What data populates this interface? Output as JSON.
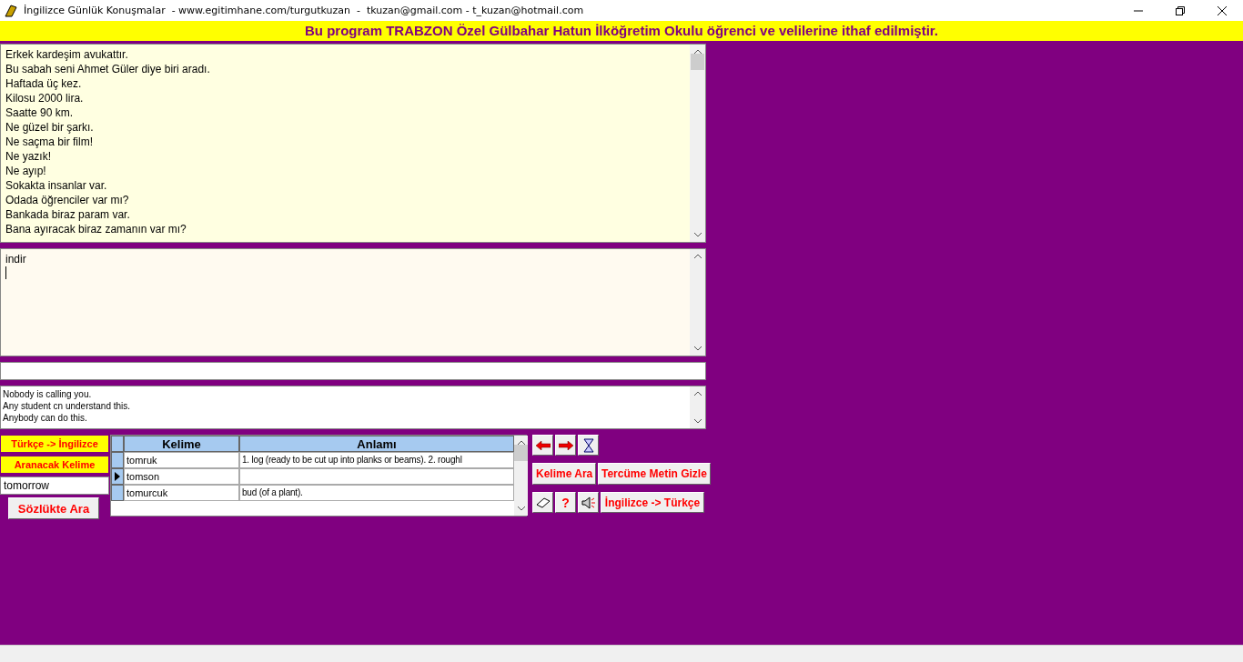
{
  "window": {
    "title": "İngilizce Günlük Konuşmalar  - www.egitimhane.com/turgutkuzan  -  tkuzan@gmail.com - t_kuzan@hotmail.com"
  },
  "banner": "Bu program TRABZON Özel Gülbahar Hatun İlköğretim Okulu öğrenci ve velilerine ithaf edilmiştir.",
  "sentences": [
    "Erkek kardeşim avukattır.",
    "Bu sabah seni Ahmet Güler diye biri aradı.",
    "Haftada üç kez.",
    "Kilosu 2000 lira.",
    "Saatte 90 km.",
    "Ne güzel bir şarkı.",
    "Ne saçma bir film!",
    "Ne yazık!",
    "Ne ayıp!",
    "Sokakta insanlar var.",
    "Odada öğrenciler var mı?",
    "Bankada biraz param var.",
    "Bana ayıracak biraz zamanın var mı?"
  ],
  "editor": {
    "value": "indir"
  },
  "examples": [
    "Nobody is calling you.",
    "Any student cn understand this.",
    "Anybody can do this."
  ],
  "direction_label": "Türkçe -> İngilizce",
  "search_label": "Aranacak Kelime",
  "search_value": "tomorrow",
  "search_button": "Sözlükte Ara",
  "table": {
    "columns": [
      "Kelime",
      "Anlamı"
    ],
    "rows": [
      {
        "word": "tomruk",
        "meaning": "1. log (ready to be cut up into planks or beams). 2. roughl",
        "selected": false
      },
      {
        "word": "tomson",
        "meaning": "",
        "selected": true
      },
      {
        "word": "tomurcuk",
        "meaning": "bud (of a plant).",
        "selected": false
      }
    ]
  },
  "buttons": {
    "word_search": "Kelime Ara",
    "hide_translation": "Tercüme Metin Gizle",
    "help": "?",
    "direction": "İngilizce -> Türkçe"
  }
}
